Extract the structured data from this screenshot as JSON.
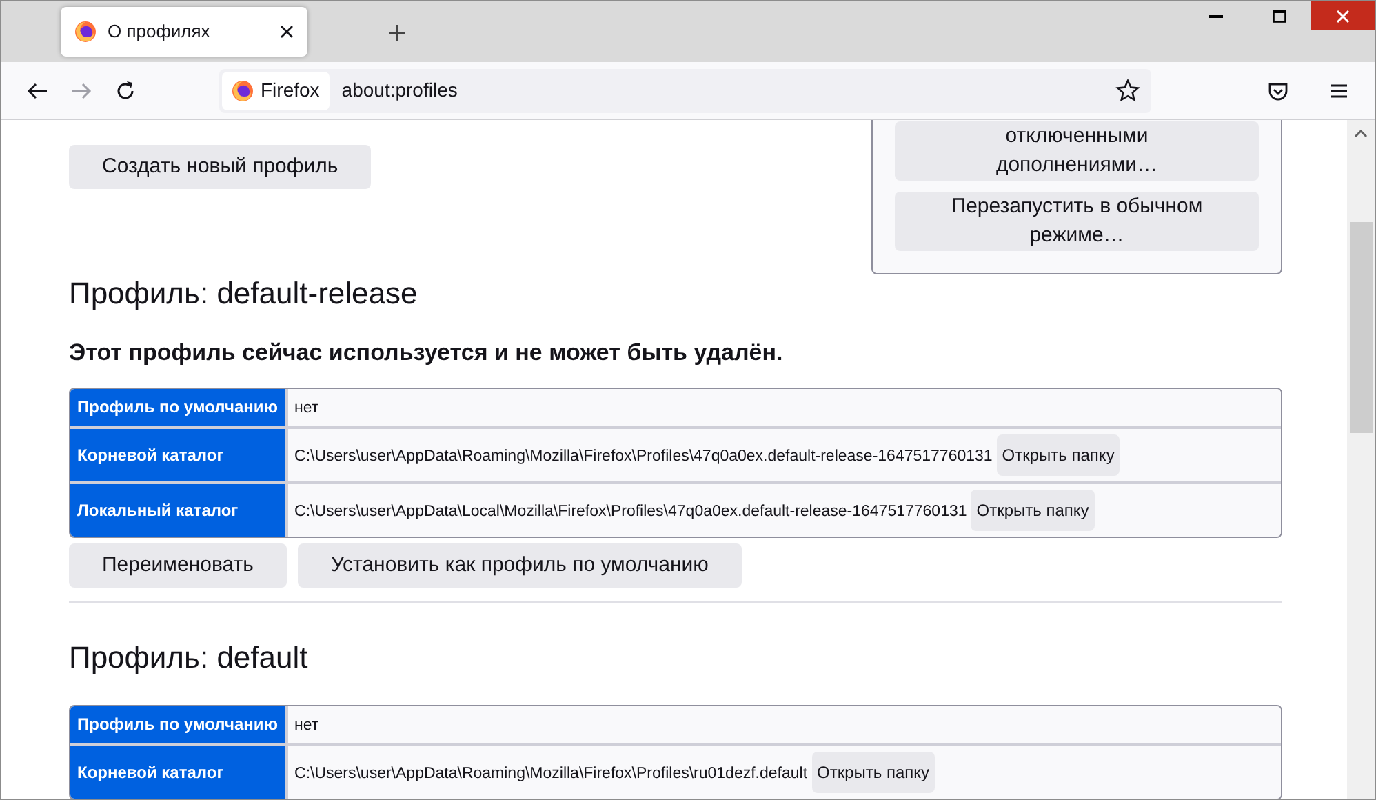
{
  "tabs": [
    {
      "title": "О профилях",
      "selected": true
    }
  ],
  "toolbar": {
    "identity": "Firefox",
    "url": "about:profiles"
  },
  "create_button": "Создать новый профиль",
  "side_panel": {
    "buttons": [
      "отключенными дополнениями…",
      "Перезапустить в обычном режиме…"
    ]
  },
  "profiles": [
    {
      "heading": "Профиль: default-release",
      "notice": "Этот профиль сейчас используется и не может быть удалён.",
      "rows": [
        {
          "label": "Профиль по умолчанию",
          "value": "нет"
        },
        {
          "label": "Корневой каталог",
          "value": "C:\\Users\\user\\AppData\\Roaming\\Mozilla\\Firefox\\Profiles\\47q0a0ex.default-release-1647517760131",
          "button": "Открыть папку"
        },
        {
          "label": "Локальный каталог",
          "value": "C:\\Users\\user\\AppData\\Local\\Mozilla\\Firefox\\Profiles\\47q0a0ex.default-release-1647517760131",
          "button": "Открыть папку"
        }
      ],
      "actions": [
        "Переименовать",
        "Установить как профиль по умолчанию"
      ]
    },
    {
      "heading": "Профиль: default",
      "rows": [
        {
          "label": "Профиль по умолчанию",
          "value": "нет"
        },
        {
          "label": "Корневой каталог",
          "value": "C:\\Users\\user\\AppData\\Roaming\\Mozilla\\Firefox\\Profiles\\ru01dezf.default",
          "button": "Открыть папку"
        }
      ]
    }
  ]
}
